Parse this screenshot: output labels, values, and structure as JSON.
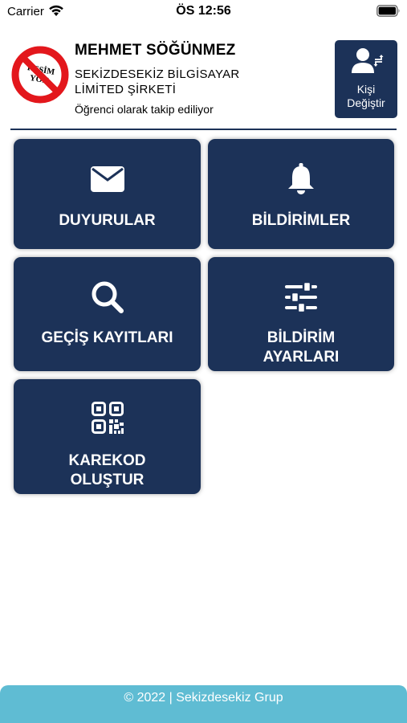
{
  "status_bar": {
    "carrier": "Carrier",
    "time": "ÖS 12:56",
    "icons": [
      "wifi-icon",
      "battery-icon"
    ]
  },
  "profile": {
    "name": "MEHMET SÖĞÜNMEZ",
    "company_line1": "SEKİZDESEKİZ BİLGİSAYAR",
    "company_line2": "LİMİTED ŞİRKETİ",
    "status": "Öğrenci olarak takip ediliyor",
    "avatar_text_1": "RESİM",
    "avatar_text_2": "YOK"
  },
  "switch_button": {
    "line1": "Kişi",
    "line2": "Değiştir",
    "icon": "user-switch-icon"
  },
  "menu": {
    "announcements": {
      "label": "DUYURULAR",
      "icon": "envelope-icon"
    },
    "notifications": {
      "label": "BİLDİRİMLER",
      "icon": "bell-icon"
    },
    "access_logs": {
      "label": "GEÇİŞ KAYITLARI",
      "icon": "search-icon"
    },
    "notification_settings": {
      "line1": "BİLDİRİM",
      "line2": "AYARLARI",
      "icon": "sliders-icon"
    },
    "qr_create": {
      "line1": "KAREKOD",
      "line2": "OLUŞTUR",
      "icon": "qr-code-icon"
    }
  },
  "footer": {
    "text": "© 2022 | Sekizdesekiz Grup"
  },
  "colors": {
    "primary": "#1c3258",
    "footer": "#5fbcd3",
    "prohibit_red": "#e3171c"
  }
}
